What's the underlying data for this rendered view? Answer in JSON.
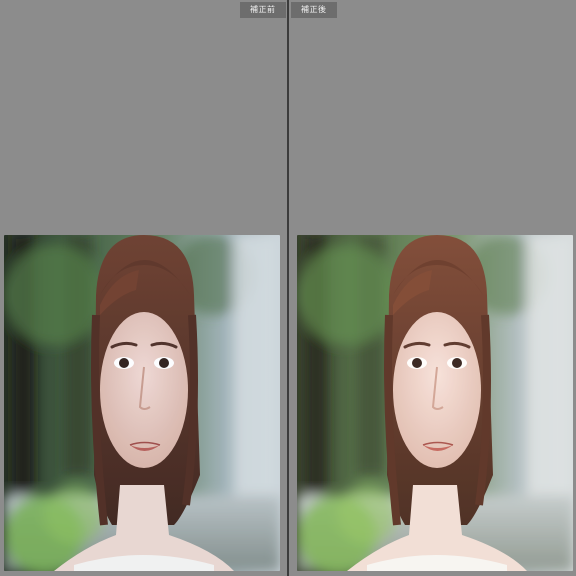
{
  "panels": {
    "before": {
      "label": "補正前",
      "image": "portrait-photo-before",
      "tone": "cool"
    },
    "after": {
      "label": "補正後",
      "image": "portrait-photo-after",
      "tone": "warm"
    }
  },
  "colors": {
    "workspace_bg": "#8c8c8c",
    "divider": "#3c3c3c",
    "tag_bg": "#6d6d6d",
    "tag_text": "#f0f0f0"
  }
}
